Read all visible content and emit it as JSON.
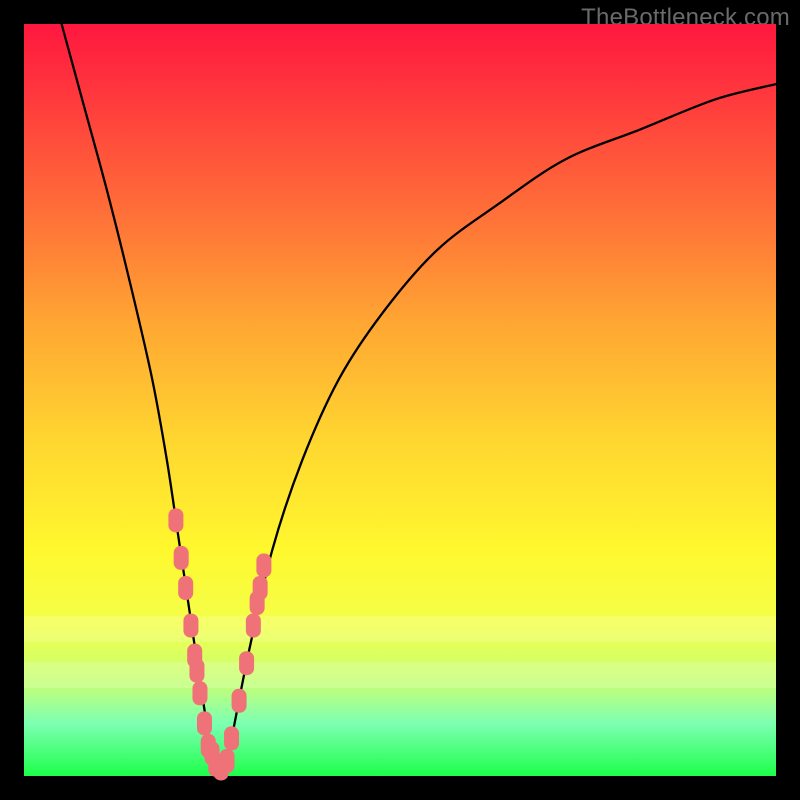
{
  "watermark": "TheBottleneck.com",
  "colors": {
    "gradient_top": "#ff173f",
    "gradient_bottom": "#1dff4a",
    "curve": "#000000",
    "marker": "#ee7278",
    "frame_bg": "#000000"
  },
  "chart_data": {
    "type": "line",
    "title": "",
    "xlabel": "",
    "ylabel": "",
    "xlim": [
      0,
      100
    ],
    "ylim": [
      0,
      100
    ],
    "grid": false,
    "legend": false,
    "series": [
      {
        "name": "bottleneck-curve",
        "x": [
          5,
          8,
          11,
          14,
          17,
          19,
          20.5,
          22,
          23.5,
          25,
          26,
          27,
          28,
          30,
          33,
          37,
          42,
          48,
          55,
          63,
          72,
          82,
          92,
          100
        ],
        "y": [
          100,
          89,
          78,
          66,
          53,
          42,
          32,
          22,
          12,
          3,
          0.5,
          2,
          7,
          17,
          30,
          42,
          53,
          62,
          70,
          76,
          82,
          86,
          90,
          92
        ]
      }
    ],
    "markers": {
      "name": "highlight-points",
      "x": [
        20.2,
        20.9,
        21.5,
        22.2,
        22.7,
        23.0,
        23.4,
        24.0,
        24.5,
        25.0,
        25.5,
        26.2,
        27.0,
        27.6,
        28.6,
        29.6,
        30.5,
        31.0,
        31.4,
        31.9
      ],
      "y": [
        34,
        29,
        25,
        20,
        16,
        14,
        11,
        7,
        4,
        3,
        1.5,
        1,
        2,
        5,
        10,
        15,
        20,
        23,
        25,
        28
      ]
    },
    "pale_bands_y": [
      [
        18,
        21
      ],
      [
        12,
        15
      ]
    ]
  }
}
